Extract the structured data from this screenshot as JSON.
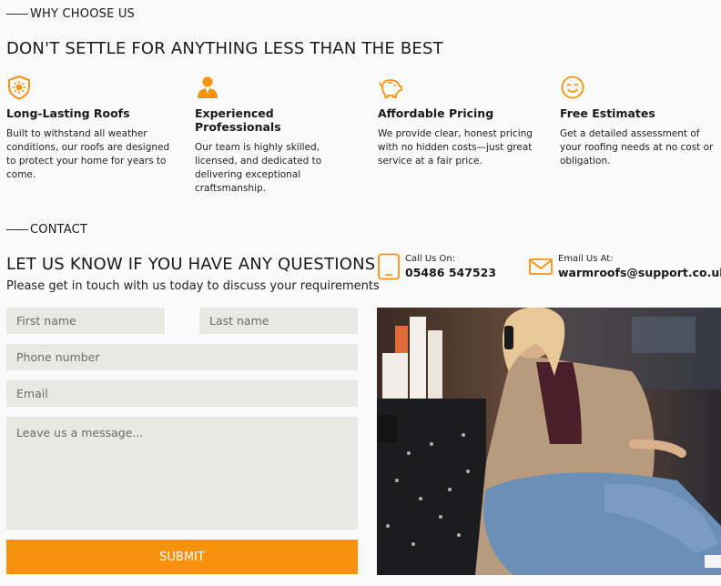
{
  "why": {
    "label": "WHY CHOOSE US",
    "title": "DON'T SETTLE FOR ANYTHING LESS THAN THE BEST",
    "features": [
      {
        "icon": "shield-sun-icon",
        "title": "Long-Lasting Roofs",
        "text": "Built to withstand all weather conditions, our roofs are designed to protect your home for years to come."
      },
      {
        "icon": "worker-icon",
        "title": "Experienced Professionals",
        "text": "Our team is highly skilled, licensed, and dedicated to delivering exceptional craftsmanship."
      },
      {
        "icon": "piggy-bank-icon",
        "title": "Affordable Pricing",
        "text": "We provide clear, honest pricing with no hidden costs—just great service at a fair price."
      },
      {
        "icon": "smiley-icon",
        "title": "Free Estimates",
        "text": "Get a detailed assessment of your roofing needs at no cost or obligation."
      }
    ]
  },
  "contact": {
    "label": "CONTACT",
    "title": "LET US KNOW IF YOU HAVE ANY QUESTIONS",
    "subtitle": "Please get in touch with us today to discuss your requirements",
    "call_label": "Call Us On:",
    "phone": "05486 547523",
    "email_label": "Email Us At:",
    "email": "warmroofs@support.co.uk",
    "form": {
      "first_name_placeholder": "First name",
      "last_name_placeholder": "Last name",
      "phone_placeholder": "Phone number",
      "email_placeholder": "Email",
      "message_placeholder": "Leave us a message...",
      "submit_label": "SUBMIT"
    }
  },
  "colors": {
    "accent": "#f7920f",
    "field_bg": "#e9e9e4",
    "page_bg": "#fafafa"
  }
}
